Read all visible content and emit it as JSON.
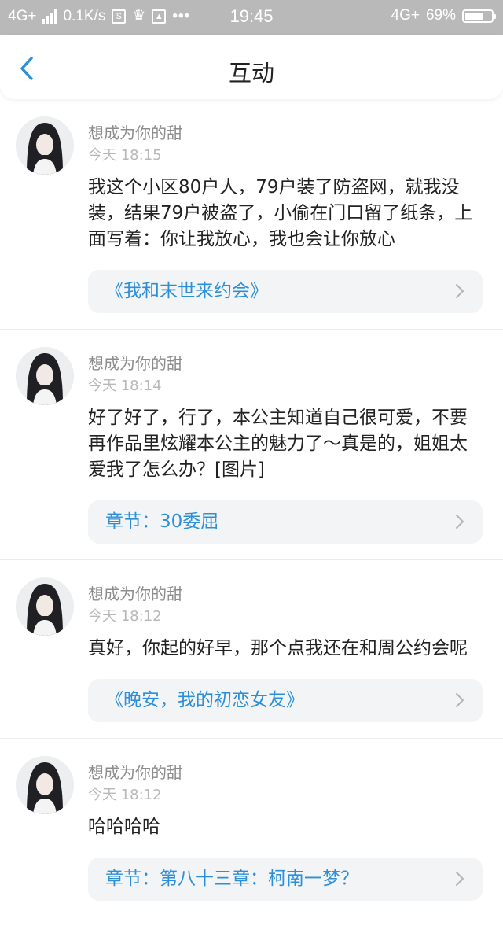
{
  "status_bar": {
    "network": "4G+",
    "speed": "0.1K/s",
    "time": "19:45",
    "network_right": "4G+",
    "battery": "69%",
    "battery_level": 0.69
  },
  "header": {
    "title": "互动"
  },
  "items": [
    {
      "username": "想成为你的甜",
      "time": "今天 18:15",
      "text": "我这个小区80户人，79户装了防盗网，就我没装，结果79户被盗了，小偷在门口留了纸条，上面写着：你让我放心，我也会让你放心",
      "link": "《我和末世来约会》"
    },
    {
      "username": "想成为你的甜",
      "time": "今天 18:14",
      "text": "好了好了，行了，本公主知道自己很可爱，不要再作品里炫耀本公主的魅力了～真是的，姐姐太爱我了怎么办？[图片]",
      "link": "章节：30委屈"
    },
    {
      "username": "想成为你的甜",
      "time": "今天 18:12",
      "text": "真好，你起的好早，那个点我还在和周公约会呢",
      "link": "《晚安，我的初恋女友》"
    },
    {
      "username": "想成为你的甜",
      "time": "今天 18:12",
      "text": "哈哈哈哈",
      "link": "章节：第八十三章：柯南一梦？"
    }
  ]
}
